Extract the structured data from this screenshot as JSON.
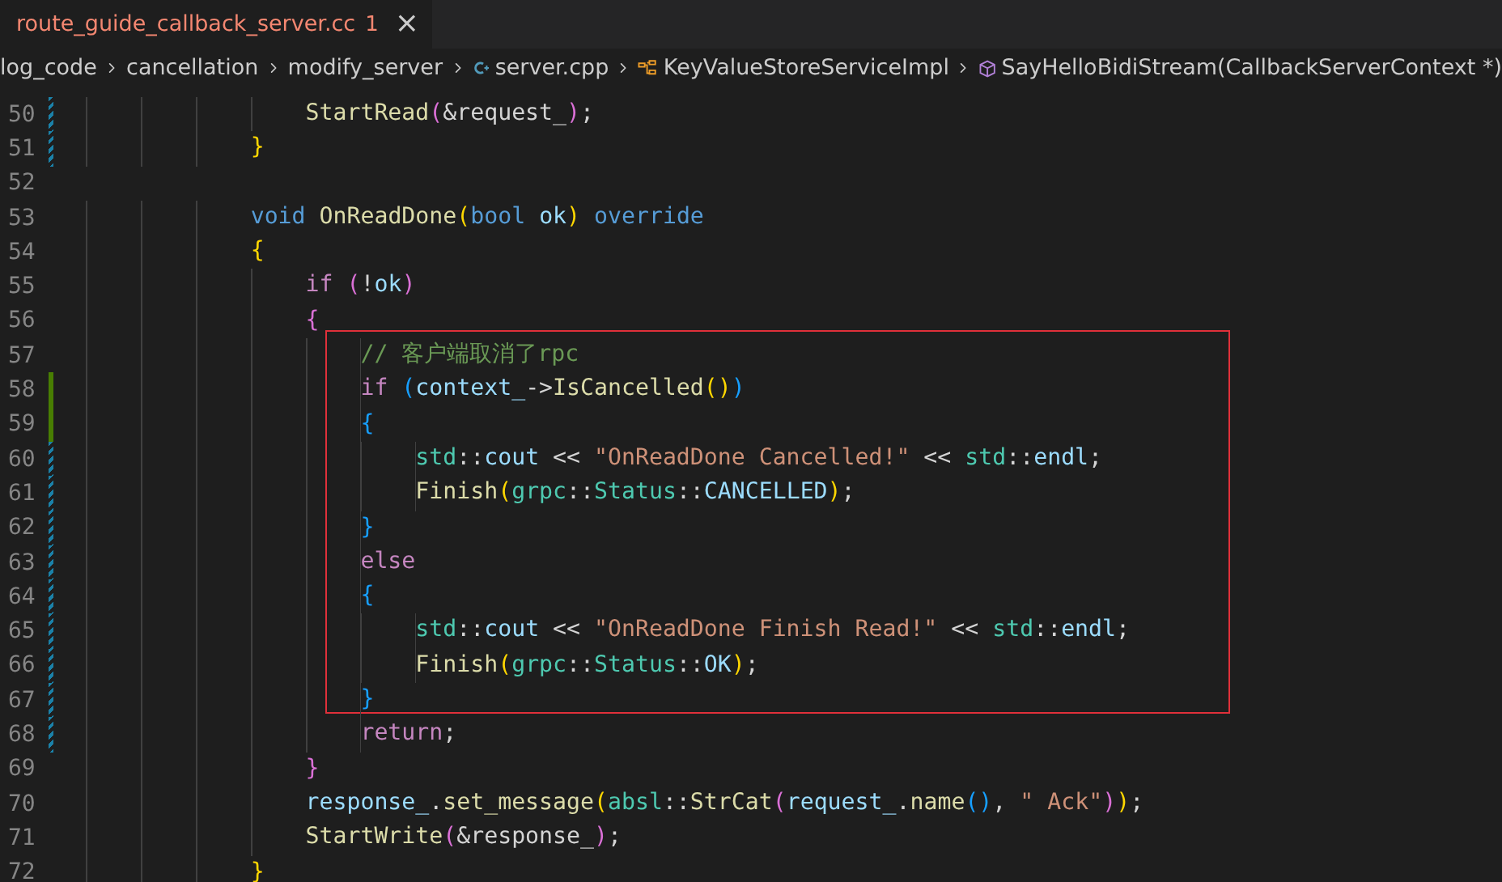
{
  "tab": {
    "title": "route_guide_callback_server.cc",
    "problems": "1",
    "has_error": true,
    "close": "×"
  },
  "breadcrumbs": [
    {
      "label": "log_code",
      "kind": "folder"
    },
    {
      "label": "cancellation",
      "kind": "folder"
    },
    {
      "label": "modify_server",
      "kind": "folder"
    },
    {
      "label": "server.cpp",
      "kind": "file"
    },
    {
      "label": "KeyValueStoreServiceImpl",
      "kind": "class"
    },
    {
      "label": "SayHelloBidiStream(CallbackServerContext *)",
      "kind": "method"
    }
  ],
  "lines": [
    {
      "number": "50",
      "modified": true,
      "added": false,
      "boxed": false,
      "tokens": [
        {
          "text": "                StartRead",
          "kind": "fn"
        },
        {
          "text": "(",
          "kind": "b2"
        },
        {
          "text": "&request_",
          "kind": "p"
        },
        {
          "text": ")",
          "kind": "b2"
        },
        {
          "text": ";",
          "kind": "p"
        }
      ]
    },
    {
      "number": "51",
      "modified": true,
      "added": false,
      "boxed": false,
      "tokens": [
        {
          "text": "            }",
          "kind": "b1"
        }
      ]
    },
    {
      "number": "52",
      "modified": false,
      "added": false,
      "boxed": false
    },
    {
      "number": "53",
      "modified": false,
      "added": false,
      "boxed": false,
      "tokens": [
        {
          "text": "            void ",
          "kind": "st"
        },
        {
          "text": "OnReadDone",
          "kind": "fn"
        },
        {
          "text": "(",
          "kind": "b1"
        },
        {
          "text": "bool ",
          "kind": "st"
        },
        {
          "text": "ok",
          "kind": "var"
        },
        {
          "text": ")",
          "kind": "b1"
        },
        {
          "text": " override",
          "kind": "st"
        }
      ]
    },
    {
      "number": "54",
      "modified": false,
      "added": false,
      "boxed": false,
      "tokens": [
        {
          "text": "            {",
          "kind": "b1"
        }
      ]
    },
    {
      "number": "55",
      "modified": false,
      "added": false,
      "boxed": false,
      "tokens": [
        {
          "text": "                if ",
          "kind": "kw"
        },
        {
          "text": "(",
          "kind": "b2"
        },
        {
          "text": "!",
          "kind": "p"
        },
        {
          "text": "ok",
          "kind": "var"
        },
        {
          "text": ")",
          "kind": "b2"
        }
      ]
    },
    {
      "number": "56",
      "modified": false,
      "added": false,
      "boxed": false,
      "tokens": [
        {
          "text": "                {",
          "kind": "b2"
        }
      ]
    },
    {
      "number": "57",
      "modified": false,
      "added": false,
      "boxed": true,
      "tokens": [
        {
          "text": "                    // 客户端取消了rpc",
          "kind": "cm"
        }
      ]
    },
    {
      "number": "58",
      "modified": false,
      "added": true,
      "boxed": true,
      "tokens": [
        {
          "text": "                    if ",
          "kind": "kw"
        },
        {
          "text": "(",
          "kind": "b3"
        },
        {
          "text": "context_",
          "kind": "var"
        },
        {
          "text": "->",
          "kind": "p"
        },
        {
          "text": "IsCancelled",
          "kind": "fn"
        },
        {
          "text": "()",
          "kind": "b1"
        },
        {
          "text": ")",
          "kind": "b3"
        }
      ]
    },
    {
      "number": "59",
      "modified": false,
      "added": true,
      "boxed": true,
      "tokens": [
        {
          "text": "                    {",
          "kind": "b3"
        }
      ]
    },
    {
      "number": "60",
      "modified": true,
      "added": false,
      "boxed": true,
      "tokens": [
        {
          "text": "                        std",
          "kind": "ns"
        },
        {
          "text": "::",
          "kind": "p"
        },
        {
          "text": "cout",
          "kind": "var"
        },
        {
          "text": " << ",
          "kind": "p"
        },
        {
          "text": "\"OnReadDone Cancelled!\"",
          "kind": "str"
        },
        {
          "text": " << ",
          "kind": "p"
        },
        {
          "text": "std",
          "kind": "ns"
        },
        {
          "text": "::",
          "kind": "p"
        },
        {
          "text": "endl",
          "kind": "var"
        },
        {
          "text": ";",
          "kind": "p"
        }
      ]
    },
    {
      "number": "61",
      "modified": true,
      "added": false,
      "boxed": true,
      "tokens": [
        {
          "text": "                        Finish",
          "kind": "fn"
        },
        {
          "text": "(",
          "kind": "b1"
        },
        {
          "text": "grpc",
          "kind": "ns"
        },
        {
          "text": "::",
          "kind": "p"
        },
        {
          "text": "Status",
          "kind": "ns"
        },
        {
          "text": "::",
          "kind": "p"
        },
        {
          "text": "CANCELLED",
          "kind": "var"
        },
        {
          "text": ")",
          "kind": "b1"
        },
        {
          "text": ";",
          "kind": "p"
        }
      ]
    },
    {
      "number": "62",
      "modified": true,
      "added": false,
      "boxed": true,
      "tokens": [
        {
          "text": "                    }",
          "kind": "b3"
        }
      ]
    },
    {
      "number": "63",
      "modified": true,
      "added": false,
      "boxed": true,
      "tokens": [
        {
          "text": "                    else",
          "kind": "kw"
        }
      ]
    },
    {
      "number": "64",
      "modified": true,
      "added": false,
      "boxed": true,
      "tokens": [
        {
          "text": "                    {",
          "kind": "b3"
        }
      ]
    },
    {
      "number": "65",
      "modified": true,
      "added": false,
      "boxed": true,
      "tokens": [
        {
          "text": "                        std",
          "kind": "ns"
        },
        {
          "text": "::",
          "kind": "p"
        },
        {
          "text": "cout",
          "kind": "var"
        },
        {
          "text": " << ",
          "kind": "p"
        },
        {
          "text": "\"OnReadDone Finish Read!\"",
          "kind": "str"
        },
        {
          "text": " << ",
          "kind": "p"
        },
        {
          "text": "std",
          "kind": "ns"
        },
        {
          "text": "::",
          "kind": "p"
        },
        {
          "text": "endl",
          "kind": "var"
        },
        {
          "text": ";",
          "kind": "p"
        }
      ]
    },
    {
      "number": "66",
      "modified": true,
      "added": false,
      "boxed": true,
      "tokens": [
        {
          "text": "                        Finish",
          "kind": "fn"
        },
        {
          "text": "(",
          "kind": "b1"
        },
        {
          "text": "grpc",
          "kind": "ns"
        },
        {
          "text": "::",
          "kind": "p"
        },
        {
          "text": "Status",
          "kind": "ns"
        },
        {
          "text": "::",
          "kind": "p"
        },
        {
          "text": "OK",
          "kind": "var"
        },
        {
          "text": ")",
          "kind": "b1"
        },
        {
          "text": ";",
          "kind": "p"
        }
      ]
    },
    {
      "number": "67",
      "modified": true,
      "added": false,
      "boxed": true,
      "tokens": [
        {
          "text": "                    }",
          "kind": "b3"
        }
      ]
    },
    {
      "number": "68",
      "modified": true,
      "added": false,
      "boxed": false,
      "tokens": [
        {
          "text": "                    return",
          "kind": "kw"
        },
        {
          "text": ";",
          "kind": "p"
        }
      ]
    },
    {
      "number": "69",
      "modified": false,
      "added": false,
      "boxed": false,
      "tokens": [
        {
          "text": "                }",
          "kind": "b2"
        }
      ]
    },
    {
      "number": "70",
      "modified": false,
      "added": false,
      "boxed": false,
      "tokens": [
        {
          "text": "                response_",
          "kind": "var"
        },
        {
          "text": ".",
          "kind": "p"
        },
        {
          "text": "set_message",
          "kind": "fn"
        },
        {
          "text": "(",
          "kind": "b1"
        },
        {
          "text": "absl",
          "kind": "ns"
        },
        {
          "text": "::",
          "kind": "p"
        },
        {
          "text": "StrCat",
          "kind": "fn"
        },
        {
          "text": "(",
          "kind": "b2"
        },
        {
          "text": "request_",
          "kind": "var"
        },
        {
          "text": ".",
          "kind": "p"
        },
        {
          "text": "name",
          "kind": "fn"
        },
        {
          "text": "()",
          "kind": "b3"
        },
        {
          "text": ", ",
          "kind": "p"
        },
        {
          "text": "\" Ack\"",
          "kind": "str"
        },
        {
          "text": ")",
          "kind": "b2"
        },
        {
          "text": ")",
          "kind": "b1"
        },
        {
          "text": ";",
          "kind": "p"
        }
      ]
    },
    {
      "number": "71",
      "modified": false,
      "added": false,
      "boxed": false,
      "tokens": [
        {
          "text": "                StartWrite",
          "kind": "fn"
        },
        {
          "text": "(",
          "kind": "b2"
        },
        {
          "text": "&response_",
          "kind": "p"
        },
        {
          "text": ")",
          "kind": "b2"
        },
        {
          "text": ";",
          "kind": "p"
        }
      ]
    },
    {
      "number": "72",
      "modified": false,
      "added": false,
      "boxed": false,
      "tokens": [
        {
          "text": "            }",
          "kind": "b1"
        }
      ]
    }
  ]
}
